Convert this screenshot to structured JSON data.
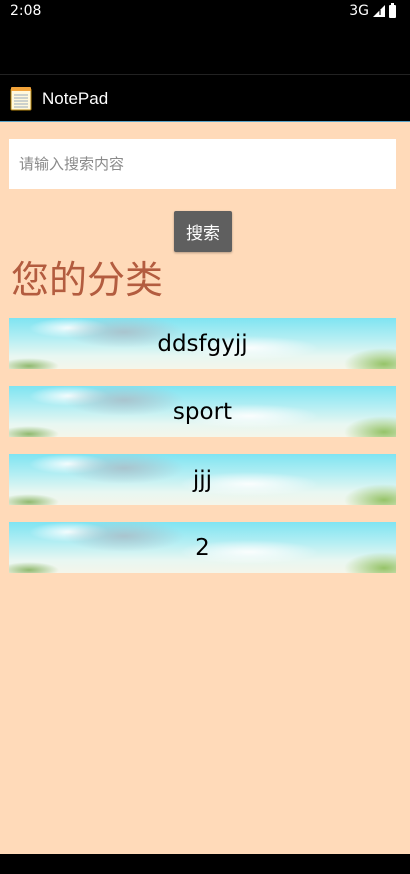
{
  "status_bar": {
    "time": "2:08",
    "network": "3G"
  },
  "app_bar": {
    "title": "NotePad",
    "icon": "notepad-icon"
  },
  "search": {
    "placeholder": "请输入搜索内容",
    "value": "",
    "button_label": "搜索"
  },
  "section": {
    "title": "您的分类"
  },
  "categories": [
    {
      "label": "ddsfgyjj"
    },
    {
      "label": "sport"
    },
    {
      "label": "jjj"
    },
    {
      "label": "2"
    }
  ],
  "colors": {
    "background": "#ffdab9",
    "section_title": "#b35c3f",
    "button": "#5f5f5f",
    "app_bar_divider": "#5aa3c8"
  }
}
